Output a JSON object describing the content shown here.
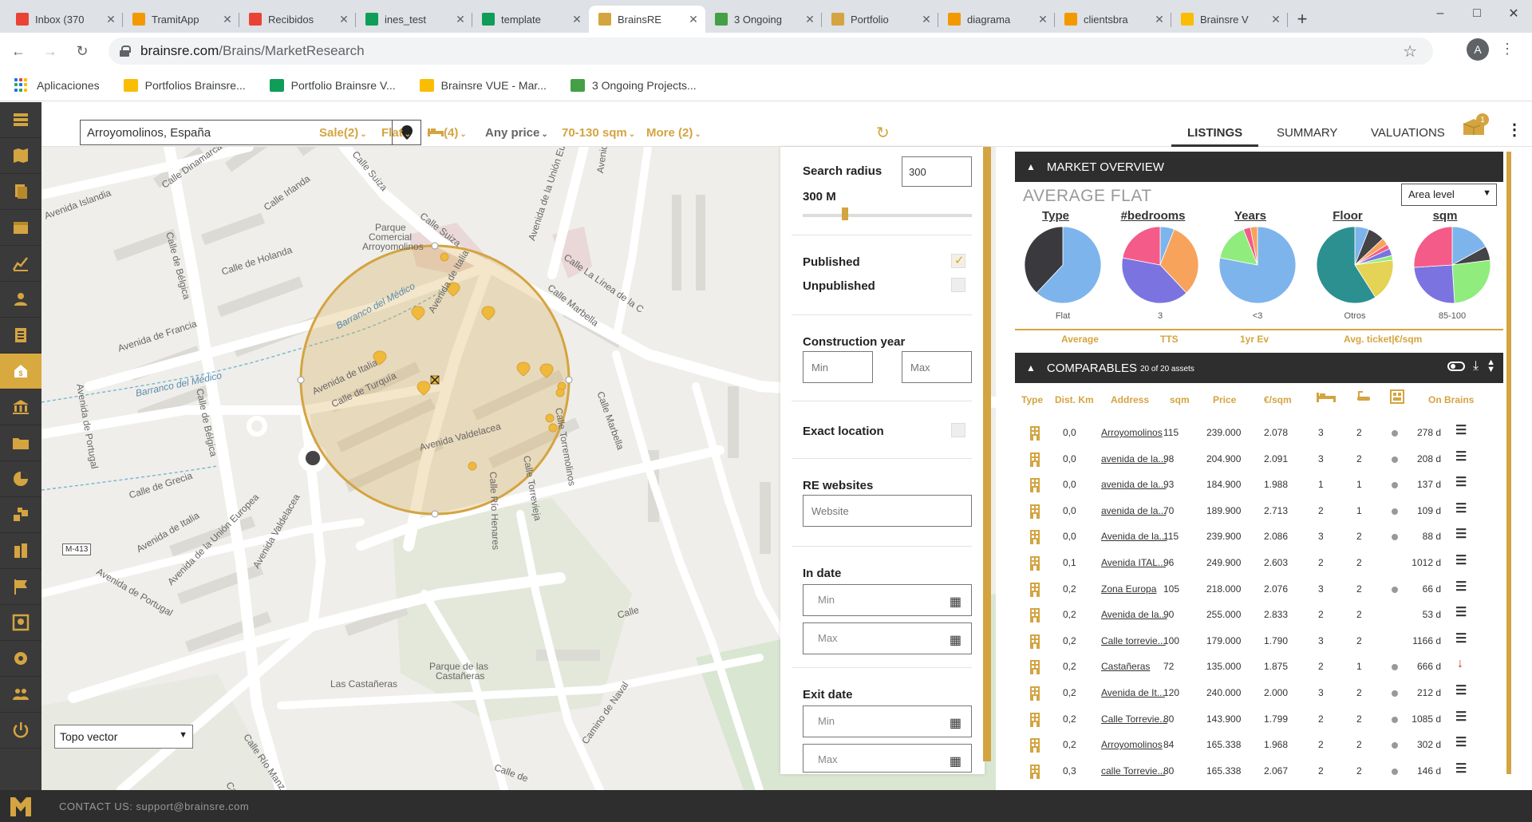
{
  "browser": {
    "tabs": [
      {
        "title": "Inbox (370",
        "favicon_color": "#ea4335",
        "icon": "gmail-icon"
      },
      {
        "title": "TramitApp",
        "favicon_color": "#f29900",
        "icon": "tramitapp-icon"
      },
      {
        "title": "Recibidos",
        "favicon_color": "#ea4335",
        "icon": "gmail-icon"
      },
      {
        "title": "ines_test",
        "favicon_color": "#0f9d58",
        "icon": "sheets-icon"
      },
      {
        "title": "template",
        "favicon_color": "#0f9d58",
        "icon": "sheets-icon"
      },
      {
        "title": "BrainsRE",
        "favicon_color": "#d4a441",
        "icon": "brains-icon"
      },
      {
        "title": "3 Ongoing",
        "favicon_color": "#43a047",
        "icon": "trello-icon"
      },
      {
        "title": "Portfolio",
        "favicon_color": "#d4a441",
        "icon": "brains-icon"
      },
      {
        "title": "diagrama",
        "favicon_color": "#f29900",
        "icon": "drawio-icon"
      },
      {
        "title": "clientsbra",
        "favicon_color": "#f29900",
        "icon": "drawio-icon"
      },
      {
        "title": "Brainsre V",
        "favicon_color": "#fbbc04",
        "icon": "slides-icon"
      }
    ],
    "active_tab": 5,
    "url_host": "brainsre.com",
    "url_path": "/Brains/MarketResearch",
    "profile_initial": "A",
    "bookmarks": [
      {
        "label": "Aplicaciones",
        "icon": "apps-grid-icon"
      },
      {
        "label": "Portfolios Brainsre...",
        "icon": "slides-icon",
        "color": "#fbbc04"
      },
      {
        "label": "Portfolio Brainsre V...",
        "icon": "sheets-icon",
        "color": "#0f9d58"
      },
      {
        "label": "Brainsre VUE - Mar...",
        "icon": "slides-icon",
        "color": "#fbbc04"
      },
      {
        "label": "3 Ongoing Projects...",
        "icon": "trello-icon",
        "color": "#43a047"
      }
    ]
  },
  "toolbar": {
    "location": "Arroyomolinos, España",
    "filters": [
      "Sale(2)",
      "Flat",
      "(4)",
      "Any price",
      "70-130 sqm",
      "More (2)"
    ],
    "tabs": [
      "LISTINGS",
      "SUMMARY",
      "VALUATIONS"
    ],
    "active_tab": "LISTINGS",
    "notification_count": "1"
  },
  "sidebar_icons": [
    "dashboard-icon",
    "map-icon",
    "documents-icon",
    "calendar-icon",
    "chart-icon",
    "user-icon",
    "list-icon",
    "market-research-icon",
    "bank-icon",
    "folder-icon",
    "pie-icon",
    "stack-icon",
    "buildings-icon",
    "flag-icon",
    "scan-icon",
    "settings-icon",
    "team-icon",
    "power-icon"
  ],
  "map": {
    "labels": [
      "Calle Dinamarca",
      "Calle Irlanda",
      "Avenida Islandia",
      "Calle de Bélgica",
      "Calle Suiza",
      "Calle Suiza",
      "Avenida de la Unión Eur",
      "Avenid",
      "Parque",
      "Comercial",
      "Arroyomolinos",
      "Calle de Holanda",
      "Calle La Línea de la C",
      "Calle Marbella",
      "Barranco del Médico",
      "Avenida de Italia",
      "Avenida de Francia",
      "Avenida de Portugal",
      "Calle de Bélgica",
      "Barranco del Médico",
      "Avenida de Italia",
      "Calle de Turquía",
      "Calle Marbella",
      "Calle Torremolinos",
      "Avenida Valdelacea",
      "Calle Río Henares",
      "Calle Torrevieja",
      "Calle de Grecia",
      "M-413",
      "Avenida de Italia",
      "Avenida de Portugal",
      "Avenida de la Unión Europea",
      "Avenida Valdelacea",
      "Parque de las",
      "Castañeras",
      "Las Castañeras",
      "Calle Río Manz",
      "Calle",
      "Camino de Naval",
      "Calle de",
      "Calle"
    ],
    "layer_select": "Topo vector"
  },
  "filter_panel": {
    "search_radius_label": "Search radius",
    "search_radius_value": "300",
    "radius_display": "300 M",
    "radius_fraction": 0.25,
    "published_label": "Published",
    "published_checked": true,
    "unpublished_label": "Unpublished",
    "unpublished_checked": false,
    "construction_year_label": "Construction year",
    "min_placeholder": "Min",
    "max_placeholder": "Max",
    "exact_location_label": "Exact location",
    "exact_location_checked": false,
    "re_websites_label": "RE websites",
    "website_placeholder": "Website",
    "in_date_label": "In date",
    "exit_date_label": "Exit date"
  },
  "market": {
    "title": "MARKET OVERVIEW",
    "subtitle": "AVERAGE FLAT",
    "area_select": "Area level",
    "pies": [
      {
        "title": "Type",
        "label": "Flat",
        "colors": [
          "#7eb4ec",
          "#3a3a3e"
        ],
        "fractions": [
          0.62,
          0.38
        ]
      },
      {
        "title": "#bedrooms",
        "label": "3",
        "colors": [
          "#7eb4ec",
          "#f7a35c",
          "#7a73e0",
          "#f45b88"
        ],
        "fractions": [
          0.06,
          0.32,
          0.4,
          0.22
        ]
      },
      {
        "title": "Years",
        "label": "<3",
        "colors": [
          "#7eb4ec",
          "#90ed7d",
          "#f45b88",
          "#f7a35c"
        ],
        "fractions": [
          0.78,
          0.16,
          0.03,
          0.03
        ]
      },
      {
        "title": "Floor",
        "label": "Otros",
        "colors": [
          "#7eb4ec",
          "#434348",
          "#f7a35c",
          "#f45b88",
          "#7a73e0",
          "#90ed7d",
          "#e4d354",
          "#2b908f"
        ],
        "fractions": [
          0.06,
          0.07,
          0.03,
          0.02,
          0.03,
          0.02,
          0.18,
          0.59
        ]
      },
      {
        "title": "sqm",
        "label": "85-100",
        "colors": [
          "#7eb4ec",
          "#434348",
          "#90ed7d",
          "#7a73e0",
          "#f45b88"
        ],
        "fractions": [
          0.17,
          0.06,
          0.26,
          0.25,
          0.26
        ]
      }
    ],
    "metrics": [
      "Average",
      "TTS",
      "1yr Ev",
      "Avg. ticket|€/sqm"
    ]
  },
  "comparables": {
    "title": "COMPARABLES",
    "count_text": "20 of 20 assets",
    "headers": {
      "type": "Type",
      "dist": "Dist. Km",
      "address": "Address",
      "sqm": "sqm",
      "price": "Price",
      "eur_sqm": "€/sqm",
      "on_brains": "On Brains"
    },
    "rows": [
      {
        "dist": "0,0",
        "address": "Arroyomolinos",
        "sqm": "115",
        "price": "239.000",
        "eur": "2.078",
        "bed": "3",
        "bath": "2",
        "dot": true,
        "days": "278 d",
        "status": "eq"
      },
      {
        "dist": "0,0",
        "address": "avenida de la...",
        "sqm": "98",
        "price": "204.900",
        "eur": "2.091",
        "bed": "3",
        "bath": "2",
        "dot": true,
        "days": "208 d",
        "status": "eq"
      },
      {
        "dist": "0,0",
        "address": "avenida de la...",
        "sqm": "93",
        "price": "184.900",
        "eur": "1.988",
        "bed": "1",
        "bath": "1",
        "dot": true,
        "days": "137 d",
        "status": "eq"
      },
      {
        "dist": "0,0",
        "address": "avenida de la...",
        "sqm": "70",
        "price": "189.900",
        "eur": "2.713",
        "bed": "2",
        "bath": "1",
        "dot": true,
        "days": "109 d",
        "status": "eq"
      },
      {
        "dist": "0,0",
        "address": "Avenida de la...",
        "sqm": "115",
        "price": "239.900",
        "eur": "2.086",
        "bed": "3",
        "bath": "2",
        "dot": true,
        "days": "88 d",
        "status": "eq"
      },
      {
        "dist": "0,1",
        "address": "Avenida ITAL...",
        "sqm": "96",
        "price": "249.900",
        "eur": "2.603",
        "bed": "2",
        "bath": "2",
        "dot": false,
        "days": "1012 d",
        "status": "eq"
      },
      {
        "dist": "0,2",
        "address": "Zona Europa",
        "sqm": "105",
        "price": "218.000",
        "eur": "2.076",
        "bed": "3",
        "bath": "2",
        "dot": true,
        "days": "66 d",
        "status": "eq"
      },
      {
        "dist": "0,2",
        "address": "Avenida de la...",
        "sqm": "90",
        "price": "255.000",
        "eur": "2.833",
        "bed": "2",
        "bath": "2",
        "dot": false,
        "days": "53 d",
        "status": "eq"
      },
      {
        "dist": "0,2",
        "address": "Calle torrevie...",
        "sqm": "100",
        "price": "179.000",
        "eur": "1.790",
        "bed": "3",
        "bath": "2",
        "dot": false,
        "days": "1166 d",
        "status": "eq"
      },
      {
        "dist": "0,2",
        "address": "Castañeras",
        "sqm": "72",
        "price": "135.000",
        "eur": "1.875",
        "bed": "2",
        "bath": "1",
        "dot": true,
        "days": "666 d",
        "status": "down"
      },
      {
        "dist": "0,2",
        "address": "Avenida de It...",
        "sqm": "120",
        "price": "240.000",
        "eur": "2.000",
        "bed": "3",
        "bath": "2",
        "dot": true,
        "days": "212 d",
        "status": "eq"
      },
      {
        "dist": "0,2",
        "address": "Calle Torrevie...",
        "sqm": "80",
        "price": "143.900",
        "eur": "1.799",
        "bed": "2",
        "bath": "2",
        "dot": true,
        "days": "1085 d",
        "status": "eq"
      },
      {
        "dist": "0,2",
        "address": "Arroyomolinos",
        "sqm": "84",
        "price": "165.338",
        "eur": "1.968",
        "bed": "2",
        "bath": "2",
        "dot": true,
        "days": "302 d",
        "status": "eq"
      },
      {
        "dist": "0,3",
        "address": "calle Torrevie...",
        "sqm": "80",
        "price": "165.338",
        "eur": "2.067",
        "bed": "2",
        "bath": "2",
        "dot": true,
        "days": "146 d",
        "status": "eq"
      }
    ]
  },
  "footer": {
    "contact": "CONTACT US: support@brainsre.com"
  }
}
